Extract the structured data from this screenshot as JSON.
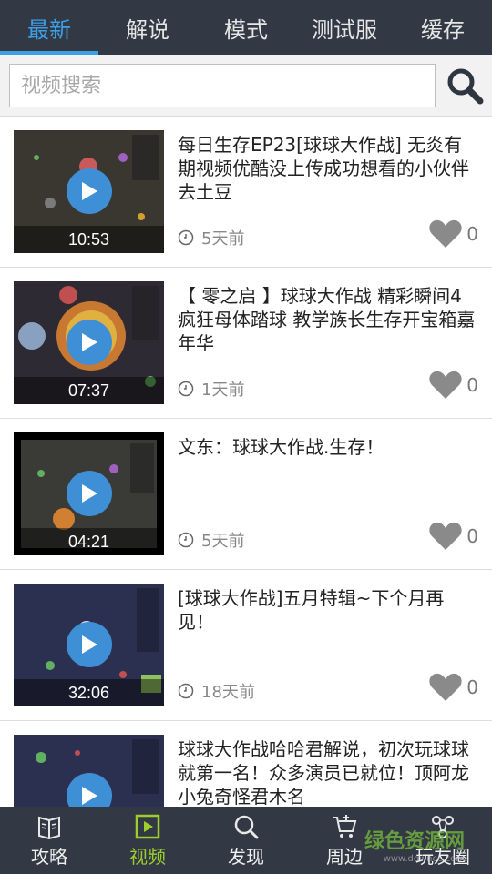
{
  "tabs": [
    {
      "label": "最新",
      "active": true
    },
    {
      "label": "解说",
      "active": false
    },
    {
      "label": "模式",
      "active": false
    },
    {
      "label": "测试服",
      "active": false
    },
    {
      "label": "缓存",
      "active": false
    }
  ],
  "search": {
    "placeholder": "视频搜索",
    "value": ""
  },
  "videos": [
    {
      "title": "每日生存EP23[球球大作战] 无炎有期视频优酷没上传成功想看的小伙伴去土豆",
      "duration": "10:53",
      "time": "5天前",
      "likes": "0"
    },
    {
      "title": "【 零之启 】球球大作战 精彩瞬间4 疯狂母体踏球 教学族长生存开宝箱嘉年华",
      "duration": "07:37",
      "time": "1天前",
      "likes": "0"
    },
    {
      "title": "文东：球球大作战.生存！",
      "duration": "04:21",
      "time": "5天前",
      "likes": "0"
    },
    {
      "title": "[球球大作战]五月特辑~下个月再见！",
      "duration": "32:06",
      "time": "18天前",
      "likes": "0"
    },
    {
      "title": "球球大作战哈哈君解说，初次玩球球就第一名！众多演员已就位！顶阿龙小兔奇怪君木名",
      "duration": "",
      "time": "",
      "likes": ""
    }
  ],
  "bottom_nav": [
    {
      "label": "攻略",
      "icon": "book-icon",
      "active": false
    },
    {
      "label": "视频",
      "icon": "video-icon",
      "active": true
    },
    {
      "label": "发现",
      "icon": "search-icon",
      "active": false
    },
    {
      "label": "周边",
      "icon": "cart-icon",
      "active": false
    },
    {
      "label": "玩友圈",
      "icon": "share-icon",
      "active": false
    }
  ],
  "watermark": {
    "text": "绿色资源网",
    "sub": "www.downcc.com"
  },
  "colors": {
    "header_bg": "#323945",
    "tab_active": "#3aa0e8",
    "nav_active": "#9ccf2d",
    "play_button": "#3f8fd6"
  }
}
